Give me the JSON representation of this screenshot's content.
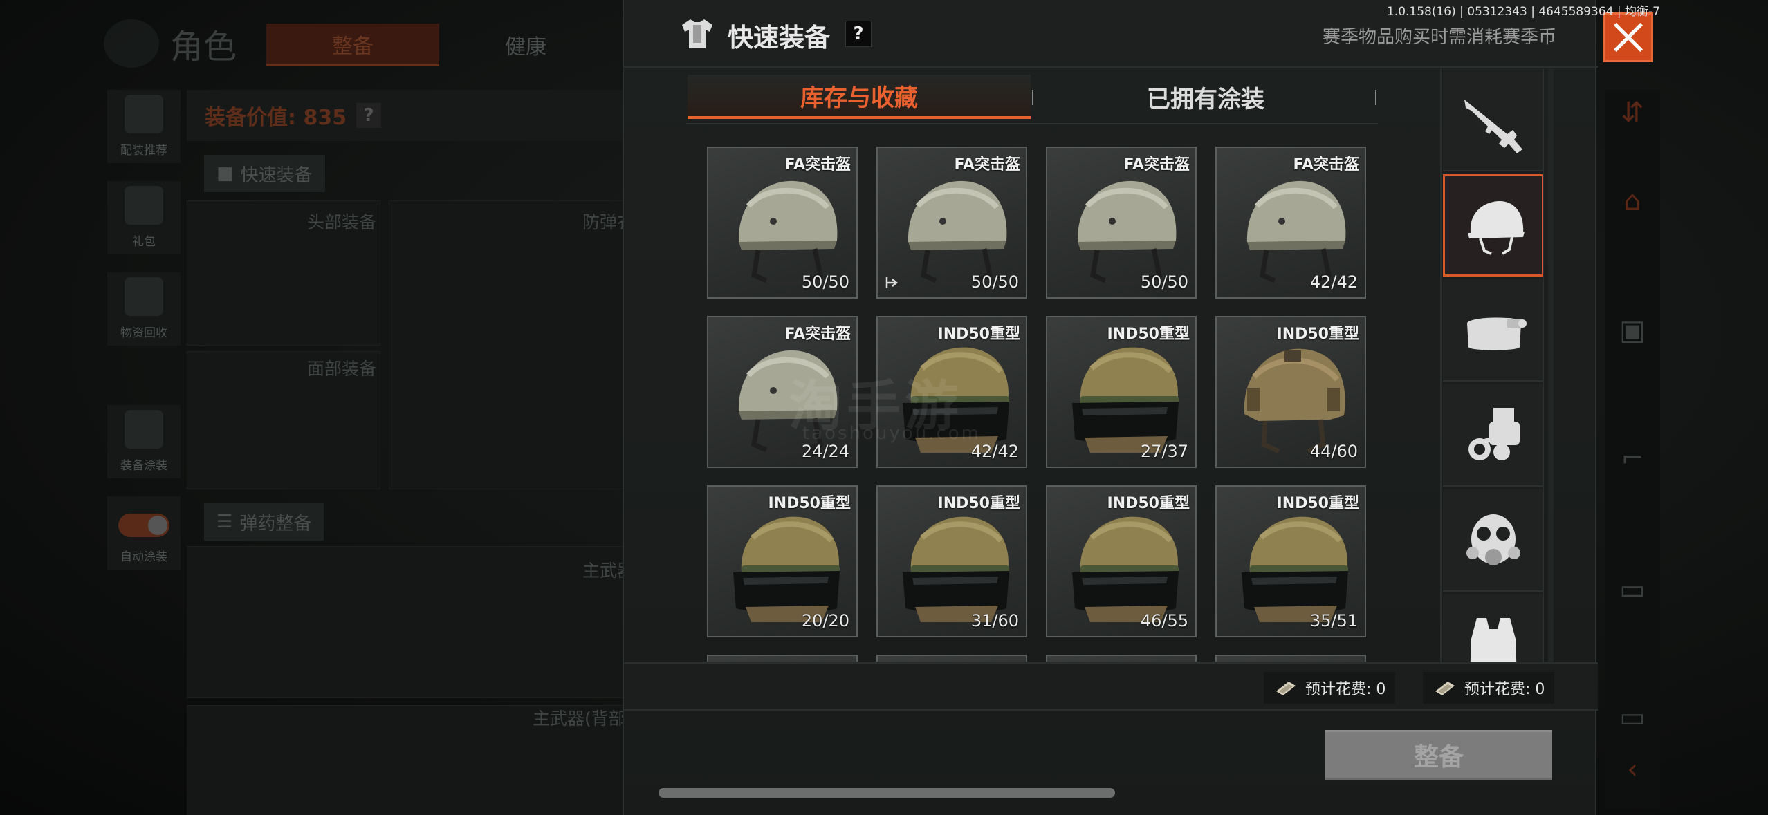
{
  "background": {
    "title": "角色",
    "tabs": [
      "整备",
      "健康"
    ],
    "side_items": [
      "配装推荐",
      "礼包",
      "物资回收",
      "装备涂装",
      "自动涂装"
    ],
    "equip_value": "装备价值: 835",
    "help": "?",
    "quick_equip_chip": "快速装备",
    "ammo_chip": "弹药整备",
    "labels": {
      "head": "头部装备",
      "armor": "防弹衣",
      "face": "面部装备",
      "primary": "主武器",
      "primary_back": "主武器(背部"
    }
  },
  "modal": {
    "title": "快速装备",
    "help": "?",
    "season_note": "赛季物品购买时需消耗赛季币",
    "tabs": [
      {
        "label": "库存与收藏",
        "active": true
      },
      {
        "label": "已拥有涂装",
        "active": false
      }
    ],
    "items": [
      {
        "name": "FA突击盔",
        "durability": "50/50",
        "kind": "fa",
        "marked": false
      },
      {
        "name": "FA突击盔",
        "durability": "50/50",
        "kind": "fa",
        "marked": true
      },
      {
        "name": "FA突击盔",
        "durability": "50/50",
        "kind": "fa",
        "marked": false
      },
      {
        "name": "FA突击盔",
        "durability": "42/42",
        "kind": "fa",
        "marked": false
      },
      {
        "name": "FA突击盔",
        "durability": "24/24",
        "kind": "fa",
        "marked": false
      },
      {
        "name": "IND50重型",
        "durability": "42/42",
        "kind": "ind",
        "marked": false
      },
      {
        "name": "IND50重型",
        "durability": "27/37",
        "kind": "ind",
        "marked": false
      },
      {
        "name": "IND50重型",
        "durability": "44/60",
        "kind": "ind-novisor",
        "marked": false
      },
      {
        "name": "IND50重型",
        "durability": "20/20",
        "kind": "ind",
        "marked": false
      },
      {
        "name": "IND50重型",
        "durability": "31/60",
        "kind": "ind",
        "marked": false
      },
      {
        "name": "IND50重型",
        "durability": "46/55",
        "kind": "ind",
        "marked": false
      },
      {
        "name": "IND50重型",
        "durability": "35/51",
        "kind": "ind",
        "marked": false
      }
    ],
    "categories": [
      {
        "icon": "rifle-icon",
        "active": false
      },
      {
        "icon": "helmet-icon",
        "active": true
      },
      {
        "icon": "headset-icon",
        "active": false
      },
      {
        "icon": "night-vision-icon",
        "active": false
      },
      {
        "icon": "gas-mask-icon",
        "active": false
      },
      {
        "icon": "vest-icon",
        "active": false
      }
    ],
    "costs": [
      "预计花费: 0",
      "预计花费: 0"
    ],
    "equip_button": "整备"
  },
  "version": "1.0.158(16) | 05312343 | 4645589364 | 均衡-7",
  "watermark": {
    "main": "淘手游",
    "sub": "taoshouyou.com"
  },
  "colors": {
    "accent": "#e8612f",
    "close": "#d24a1c",
    "button_disabled": "#7c7c7c"
  }
}
